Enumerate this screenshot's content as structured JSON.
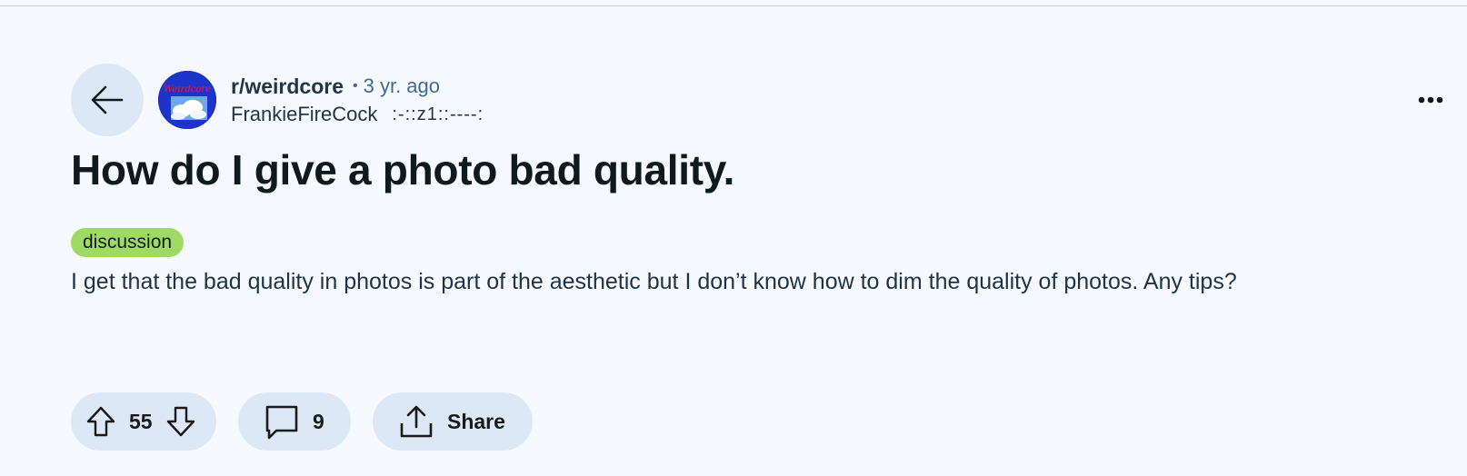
{
  "post": {
    "subreddit": "r/weirdcore",
    "separator": "•",
    "age": "3 yr. ago",
    "author": "FrankieFireCock",
    "author_flair": ":-::z1::----:",
    "title": "How do I give a photo bad quality.",
    "flair": "discussion",
    "body": "I get that the bad quality in photos is part of the aesthetic but I don’t know how to dim the quality of photos. Any tips?",
    "avatar_text": "Weirdcore"
  },
  "actions": {
    "votes": "55",
    "comments": "9",
    "share_label": "Share"
  },
  "icons": {
    "back": "back-arrow-icon",
    "more": "more-options-icon",
    "upvote": "upvote-icon",
    "downvote": "downvote-icon",
    "comment": "comment-icon",
    "share": "share-icon"
  },
  "colors": {
    "background": "#f6f9fd",
    "pill": "#dde8f6",
    "flair": "#9fdb64",
    "meta": "#3f6a91",
    "avatar": "#1d33c9"
  }
}
